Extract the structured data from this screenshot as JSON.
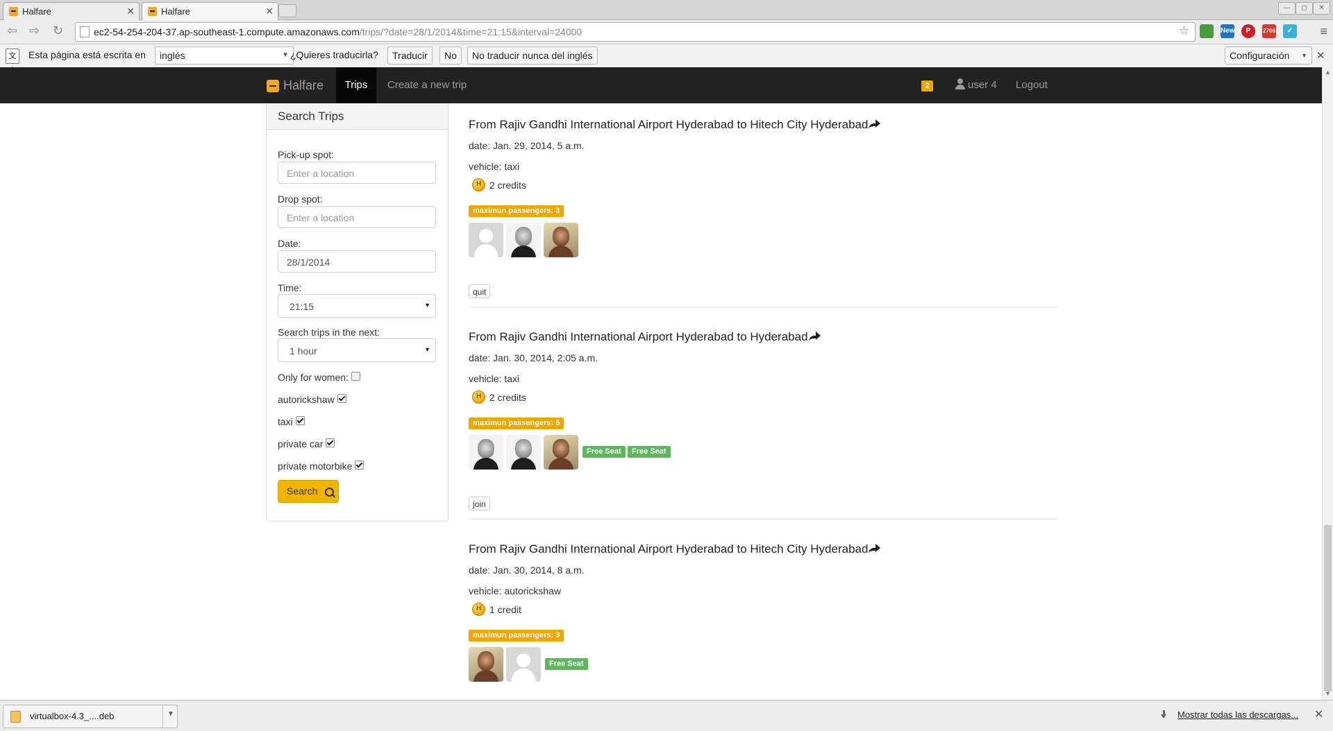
{
  "browser": {
    "tabs": [
      {
        "title": "Halfare",
        "active": false
      },
      {
        "title": "Halfare",
        "active": true
      }
    ],
    "url_host": "ec2-54-254-204-37.ap-southeast-1.compute.amazonaws.com",
    "url_path": "/trips/?date=28/1/2014&time=21:15&interval=24000",
    "extensions": [
      {
        "name": "evernote-icon",
        "color": "#4a9b3c",
        "text": ""
      },
      {
        "name": "delicious-new-icon",
        "color": "#1e73be",
        "text": "New"
      },
      {
        "name": "pinterest-icon",
        "color": "#cb2027",
        "text": "P"
      },
      {
        "name": "gmail-icon",
        "color": "#d7392c",
        "text": "2706"
      },
      {
        "name": "pushbullet-icon",
        "color": "#3cb0d6",
        "text": "✓"
      }
    ]
  },
  "translate_bar": {
    "written_in": "Esta página está escrita en",
    "language": "inglés",
    "question": "¿Quieres traducirla?",
    "translate": "Traducir",
    "no": "No",
    "never": "No traducir nunca del inglés",
    "config": "Configuración"
  },
  "nav": {
    "brand": "Halfare",
    "trips": "Trips",
    "create": "Create a new trip",
    "notifications": "2",
    "user": "user 4",
    "logout": "Logout"
  },
  "search": {
    "title": "Search Trips",
    "pickup_label": "Pick-up spot:",
    "pickup_placeholder": "Enter a location",
    "drop_label": "Drop spot:",
    "drop_placeholder": "Enter a location",
    "date_label": "Date:",
    "date_value": "28/1/2014",
    "time_label": "Time:",
    "time_value": "21:15",
    "interval_label": "Search trips in the next:",
    "interval_value": "1 hour",
    "women_label": "Only for women:",
    "women_checked": false,
    "vehicles": [
      {
        "label": "autorickshaw",
        "checked": true
      },
      {
        "label": "taxi",
        "checked": true
      },
      {
        "label": "private car",
        "checked": true
      },
      {
        "label": "private motorbike",
        "checked": true
      }
    ],
    "button": "Search"
  },
  "trips": [
    {
      "title": "From Rajiv Gandhi International Airport Hyderabad to Hitech City Hyderabad",
      "date": "date: Jan. 29, 2014, 5 a.m.",
      "vehicle": "vehicle: taxi",
      "credits": "2 credits",
      "max": "maximun passengers: 3",
      "avatars": [
        "blank",
        "dark",
        "warm"
      ],
      "free_seats": [],
      "action": "quit"
    },
    {
      "title": "From Rajiv Gandhi International Airport Hyderabad to Hyderabad",
      "date": "date: Jan. 30, 2014, 2:05 a.m.",
      "vehicle": "vehicle: taxi",
      "credits": "2 credits",
      "max": "maximun passengers: 5",
      "avatars": [
        "dark",
        "dark",
        "warm"
      ],
      "free_seats": [
        "Free Seat",
        "Free Seat"
      ],
      "action": "join"
    },
    {
      "title": "From Rajiv Gandhi International Airport Hyderabad to Hitech City Hyderabad",
      "date": "date: Jan. 30, 2014, 8 a.m.",
      "vehicle": "vehicle: autorickshaw",
      "credits": "1 credit",
      "max": "maximun passengers: 3",
      "avatars": [
        "warm",
        "blank"
      ],
      "free_seats": [
        "Free Seat"
      ],
      "action": ""
    }
  ],
  "downloads": {
    "file": "virtualbox-4.3_....deb",
    "show_all": "Mostrar todas las descargas..."
  }
}
